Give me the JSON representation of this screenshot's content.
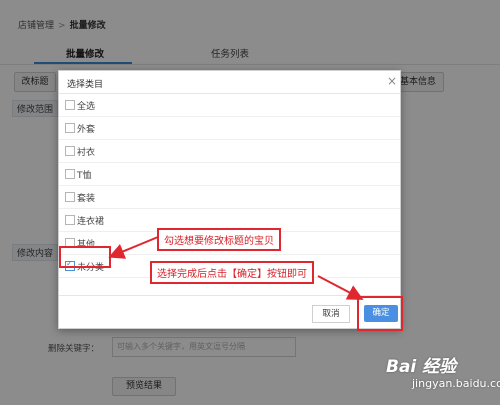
{
  "breadcrumb": {
    "root": "店铺管理",
    "separator": ">",
    "current": "批量修改"
  },
  "tabs": [
    {
      "label": "批量修改",
      "active": true
    },
    {
      "label": "任务列表",
      "active": false
    }
  ],
  "background": {
    "edit_title_button": "改标题",
    "basic_info_button": "基本信息",
    "scope_label": "修改范围",
    "content_label": "修改内容",
    "delete_keyword_label": "删除关键字：",
    "delete_keyword_placeholder": "可输入多个关键字，用英文逗号分隔",
    "preview_button": "预览结果"
  },
  "modal": {
    "title": "选择类目",
    "close_glyph": "×",
    "categories": [
      {
        "label": "全选",
        "checked": false
      },
      {
        "label": "外套",
        "checked": false
      },
      {
        "label": "衬衣",
        "checked": false
      },
      {
        "label": "T恤",
        "checked": false
      },
      {
        "label": "套装",
        "checked": false
      },
      {
        "label": "连衣裙",
        "checked": false
      },
      {
        "label": "其他",
        "checked": false
      },
      {
        "label": "未分类",
        "checked": true
      }
    ],
    "cancel_label": "取消",
    "ok_label": "确定"
  },
  "annotations": {
    "note1": "勾选想要修改标题的宝贝",
    "note2": "选择完成后点击【确定】按钮即可"
  },
  "watermark": {
    "logo": "Bai 经验",
    "sub": "jingyan.baidu.com"
  },
  "colors": {
    "accent_red": "#e0262e",
    "primary_blue": "#4a90e2",
    "tab_blue": "#3c8bd9"
  }
}
